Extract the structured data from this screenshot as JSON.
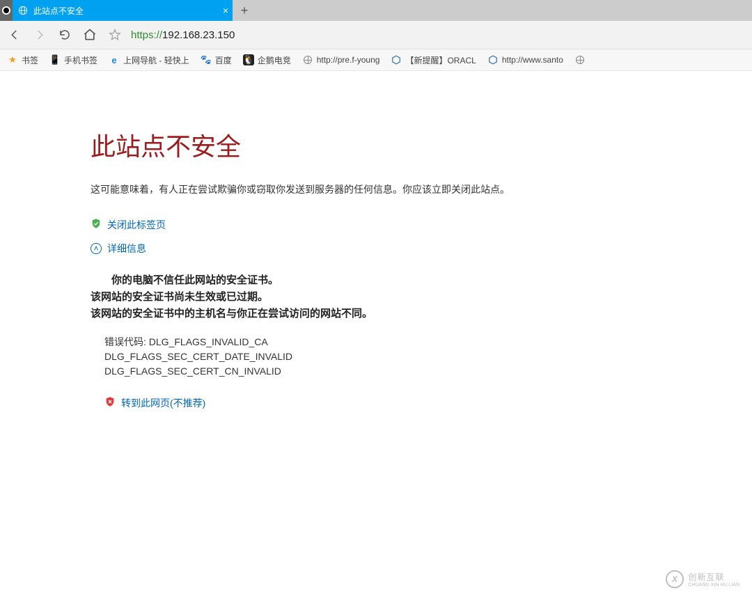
{
  "tab": {
    "title": "此站点不安全"
  },
  "url": {
    "scheme": "https://",
    "host": "192.168.23.150"
  },
  "bookmarks": {
    "b0": "书签",
    "b1": "手机书签",
    "b2": "上网导航 - 轻快上",
    "b3": "百度",
    "b4": "企鹅电竞",
    "b5": "http://pre.f-young",
    "b6": "【新提醒】ORACL",
    "b7": "http://www.santo"
  },
  "page": {
    "heading": "此站点不安全",
    "subtext": "这可能意味着，有人正在尝试欺骗你或窃取你发送到服务器的任何信息。你应该立即关闭此站点。",
    "close_tab": "关闭此标签页",
    "details": "详细信息",
    "d1": "你的电脑不信任此网站的安全证书。",
    "d2": "该网站的安全证书尚未生效或已过期。",
    "d3": "该网站的安全证书中的主机名与你正在尝试访问的网站不同。",
    "err_label": "错误代码:",
    "err1": "DLG_FLAGS_INVALID_CA",
    "err2": "DLG_FLAGS_SEC_CERT_DATE_INVALID",
    "err3": "DLG_FLAGS_SEC_CERT_CN_INVALID",
    "proceed": "转到此网页(不推荐)"
  },
  "watermark": {
    "main": "创新互联",
    "sub": "CHUANG XIN HU LIAN"
  }
}
